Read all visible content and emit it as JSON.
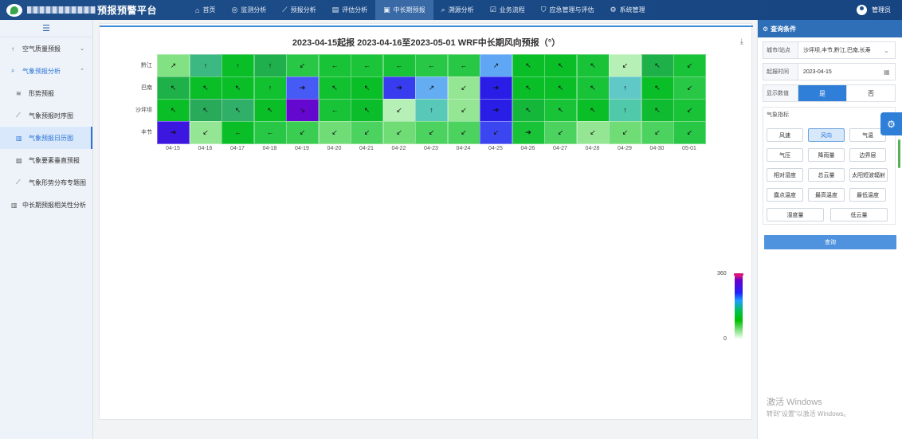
{
  "topbar": {
    "title": "预报预警平台",
    "nav": [
      {
        "icon": "home-icon",
        "glyph": "⌂",
        "label": "首页",
        "active": false
      },
      {
        "icon": "monitor-icon",
        "glyph": "◎",
        "label": "监测分析",
        "active": false
      },
      {
        "icon": "trend-icon",
        "glyph": "⟋",
        "label": "预报分析",
        "active": false
      },
      {
        "icon": "evaluate-icon",
        "glyph": "▤",
        "label": "评估分析",
        "active": false
      },
      {
        "icon": "forecast-icon",
        "glyph": "▣",
        "label": "中长期预报",
        "active": true
      },
      {
        "icon": "source-icon",
        "glyph": "⌕",
        "label": "溯源分析",
        "active": false
      },
      {
        "icon": "workflow-icon",
        "glyph": "☑",
        "label": "业务流程",
        "active": false
      },
      {
        "icon": "shield-icon",
        "glyph": "⛉",
        "label": "应急管理与评估",
        "active": false
      },
      {
        "icon": "settings-icon",
        "glyph": "⚙",
        "label": "系统管理",
        "active": false
      }
    ],
    "user": "管理员"
  },
  "sidebar": {
    "toggle_glyph": "☰",
    "items": [
      {
        "name": "sidebar-item-air-quality-forecast",
        "icon": "arrow-up-icon",
        "glyph": "↑",
        "label": "空气质量预报",
        "arrow": "⌄",
        "level": "top"
      },
      {
        "name": "sidebar-item-weather-forecast-analysis",
        "icon": "search-icon",
        "glyph": "⌕",
        "label": "气象预报分析",
        "arrow": "⌃",
        "level": "top",
        "open": true
      },
      {
        "name": "sidebar-item-situation-forecast",
        "icon": "wave-icon",
        "glyph": "≋",
        "label": "形势预报",
        "level": "sub"
      },
      {
        "name": "sidebar-item-weather-timeseries",
        "icon": "line-chart-icon",
        "glyph": "⟋",
        "label": "气象预报时序图",
        "level": "sub"
      },
      {
        "name": "sidebar-item-weather-calendar",
        "icon": "bar-chart-icon",
        "glyph": "▥",
        "label": "气象预报日历图",
        "level": "sub",
        "active": true
      },
      {
        "name": "sidebar-item-vertical-profile",
        "icon": "image-icon",
        "glyph": "▨",
        "label": "气象要素垂直预报",
        "level": "sub"
      },
      {
        "name": "sidebar-item-distribution-map",
        "icon": "line-chart-icon",
        "glyph": "⟋",
        "label": "气象形势分布专题图",
        "level": "sub"
      },
      {
        "name": "sidebar-item-correlation-analysis",
        "icon": "bar-chart-icon",
        "glyph": "▥",
        "label": "中长期预报相关性分析",
        "level": "top"
      }
    ]
  },
  "main": {
    "download_glyph": "⤓"
  },
  "chart_data": {
    "type": "heatmap",
    "title": "2023-04-15起报 2023-04-16至2023-05-01 WRF中长期风向预报（°）",
    "rows": [
      "黔江",
      "巴南",
      "沙坪坝",
      "丰节"
    ],
    "columns": [
      "04-15",
      "04-16",
      "04-17",
      "04-18",
      "04-19",
      "04-20",
      "04-21",
      "04-22",
      "04-23",
      "04-24",
      "04-25",
      "04-26",
      "04-27",
      "04-28",
      "04-29",
      "04-30",
      "05-01"
    ],
    "values": [
      [
        45,
        135,
        90,
        112,
        70,
        80,
        78,
        80,
        70,
        70,
        225,
        90,
        90,
        80,
        30,
        110,
        80
      ],
      [
        110,
        90,
        90,
        85,
        270,
        85,
        90,
        285,
        220,
        40,
        300,
        90,
        90,
        80,
        170,
        90,
        70
      ],
      [
        90,
        120,
        125,
        90,
        315,
        80,
        92,
        30,
        160,
        40,
        300,
        100,
        80,
        90,
        150,
        95,
        80
      ],
      [
        305,
        40,
        90,
        70,
        65,
        50,
        60,
        50,
        60,
        60,
        280,
        80,
        60,
        40,
        50,
        60,
        70
      ]
    ],
    "arrows": [
      [
        "↗",
        "↑",
        "↑",
        "↑",
        "↙",
        "←",
        "←",
        "←",
        "←",
        "←",
        "↗",
        "↖",
        "↖",
        "↖",
        "↙",
        "↖",
        "↙"
      ],
      [
        "↖",
        "↖",
        "↖",
        "↑",
        "➔",
        "↖",
        "↖",
        "➔",
        "↗",
        "↙",
        "➔",
        "↖",
        "↖",
        "↖",
        "↑",
        "↖",
        "↙"
      ],
      [
        "↖",
        "↖",
        "↖",
        "↖",
        "↘",
        "←",
        "↖",
        "↙",
        "↑",
        "↙",
        "➔",
        "↖",
        "↖",
        "↖",
        "↑",
        "↖",
        "↙"
      ],
      [
        "➔",
        "↙",
        "←",
        "←",
        "↙",
        "↙",
        "↙",
        "↙",
        "↙",
        "↙",
        "↙",
        "➔",
        "↙",
        "↙",
        "↙",
        "↙",
        "↙"
      ]
    ],
    "color_scale": {
      "min": 0,
      "max": 360,
      "min_label": "0",
      "max_label": "360"
    }
  },
  "rpanel": {
    "header": "查询条件",
    "city_label": "城市/站点",
    "city_value": "沙坪坝,丰节,黔江,巴南,长寿",
    "time_label": "起报时间",
    "time_value": "2023-04-15",
    "show_label": "显示数值",
    "yes": "是",
    "no": "否",
    "indicator_title": "气象指标",
    "indicators": [
      "风速",
      "风向",
      "气温",
      "气压",
      "降雨量",
      "边界层",
      "相对湿度",
      "总云量",
      "太阳短波辐射",
      "露点温度",
      "最高温度",
      "最低温度",
      "湿度量",
      "低云量"
    ],
    "selected_indicator": "风向",
    "query": "查询"
  },
  "watermark": {
    "line1": "激活 Windows",
    "line2": "转到\"设置\"以激活 Windows。"
  }
}
